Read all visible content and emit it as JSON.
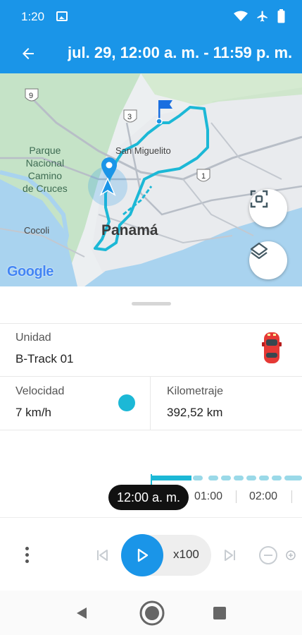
{
  "status_bar": {
    "time": "1:20",
    "icons": [
      "image-icon",
      "wifi-icon",
      "airplane-icon",
      "battery-icon"
    ]
  },
  "app_bar": {
    "title": "jul. 29, 12:00 a. m. - 11:59 p. m.",
    "back_icon": "arrow-left-icon"
  },
  "map": {
    "labels": {
      "park": "Parque\nNacional\nCamino\nde Cruces",
      "san_miguelito": "San Miguelito",
      "panama": "Panamá",
      "cocoli": "Cocoli",
      "route_9": "9",
      "route_3": "3",
      "route_1": "1"
    },
    "attribution": "Google",
    "buttons": {
      "fit_bounds_icon": "focus-frame-icon",
      "layers_icon": "layers-icon"
    },
    "colors": {
      "route": "#1cb8d6",
      "flag": "#1a6fe0",
      "marker": "#1a95e8"
    }
  },
  "sheet": {
    "unit_label": "Unidad",
    "unit_value": "B-Track 01",
    "speed_label": "Velocidad",
    "speed_value": "7 km/h",
    "odometer_label": "Kilometraje",
    "odometer_value": "392,52 km",
    "vehicle_icon": "car-icon"
  },
  "timeline": {
    "current_time": "12:00 a. m.",
    "ticks": [
      "01:00",
      "02:00"
    ]
  },
  "player": {
    "speed_multiplier": "x100",
    "icons": {
      "more": "more-vertical-icon",
      "previous": "skip-previous-icon",
      "play": "play-icon",
      "next": "skip-next-icon",
      "zoom_out": "zoom-out-icon",
      "zoom_in": "zoom-in-icon"
    }
  },
  "colors": {
    "primary": "#1a95e8",
    "accent": "#1cb8d6",
    "pill": "#111111"
  }
}
